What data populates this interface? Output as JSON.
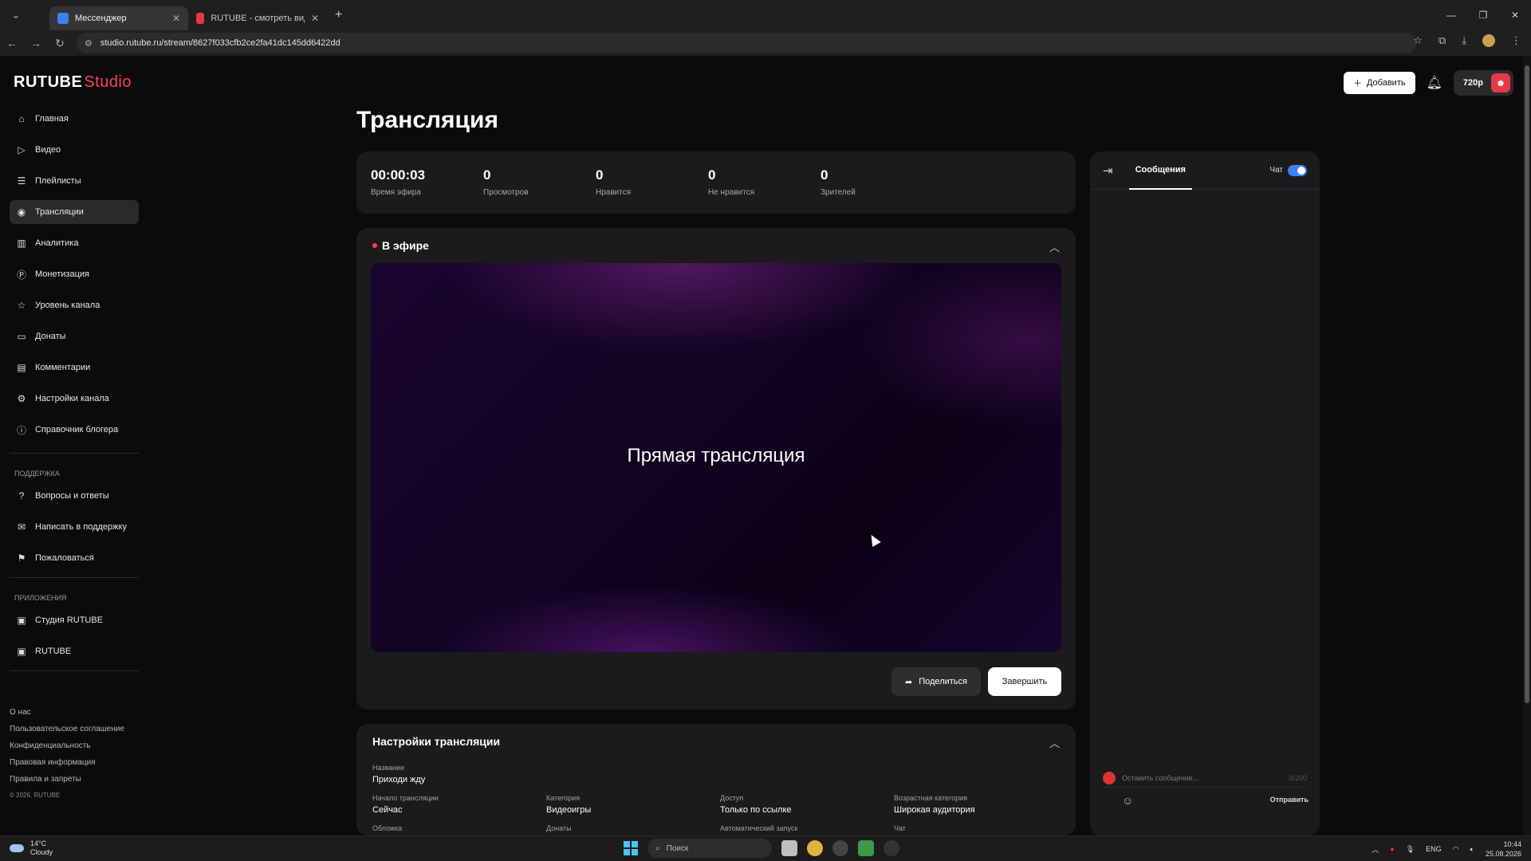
{
  "browser": {
    "tabs": [
      {
        "label": "Мессенджер",
        "active": true
      },
      {
        "label": "RUTUBE - смотреть видео он...",
        "active": false
      }
    ],
    "url": "studio.rutube.ru/stream/8627f033cfb2ce2fa41dc145dd6422dd"
  },
  "brand": {
    "logo": "RUTUBE",
    "logo_suffix": "Studio",
    "accent": "#ff3d5a"
  },
  "sidebar": {
    "items": [
      {
        "label": "Главная",
        "icon": "home-icon"
      },
      {
        "label": "Видео",
        "icon": "video-icon"
      },
      {
        "label": "Плейлисты",
        "icon": "playlist-icon"
      },
      {
        "label": "Трансляции",
        "icon": "broadcast-icon",
        "active": true
      },
      {
        "label": "Аналитика",
        "icon": "analytics-icon"
      },
      {
        "label": "Монетизация",
        "icon": "monetization-icon"
      },
      {
        "label": "Уровень канала",
        "icon": "star-icon"
      },
      {
        "label": "Донаты",
        "icon": "wallet-icon"
      },
      {
        "label": "Комментарии",
        "icon": "comment-icon"
      },
      {
        "label": "Настройки канала",
        "icon": "gear-icon"
      },
      {
        "label": "Справочник блогера",
        "icon": "info-icon"
      }
    ],
    "support_title": "ПОДДЕРЖКА",
    "support": [
      {
        "label": "Вопросы и ответы",
        "icon": "question-icon"
      },
      {
        "label": "Написать в поддержку",
        "icon": "mail-icon"
      },
      {
        "label": "Пожаловаться",
        "icon": "flag-icon"
      }
    ],
    "apps_title": "ПРИЛОЖЕНИЯ",
    "apps": [
      {
        "label": "Студия RUTUBE",
        "icon": "studio-icon"
      },
      {
        "label": "RUTUBE",
        "icon": "rutube-icon"
      }
    ],
    "footer": [
      "О нас",
      "Пользовательское соглашение",
      "Конфиденциальность",
      "Правовая информация",
      "Правила и запреты"
    ],
    "copyright": "© 2026, RUTUBE"
  },
  "header": {
    "add_label": "Добавить",
    "quality": "720p"
  },
  "page_title": "Трансляция",
  "stats": [
    {
      "value": "00:00:03",
      "label": "Время эфира"
    },
    {
      "value": "0",
      "label": "Просмотров"
    },
    {
      "value": "0",
      "label": "Нравится"
    },
    {
      "value": "0",
      "label": "Не нравится"
    },
    {
      "value": "0",
      "label": "Зрителей"
    }
  ],
  "live": {
    "status": "В эфире",
    "player_label": "Прямая трансляция",
    "share_label": "Поделиться",
    "end_label": "Завершить"
  },
  "settings": {
    "title": "Настройки трансляции",
    "name_key": "Название",
    "name_value": "Приходи жду",
    "fields": [
      {
        "key": "Начало трансляции",
        "value": "Сейчас"
      },
      {
        "key": "Категория",
        "value": "Видеоигры"
      },
      {
        "key": "Доступ",
        "value": "Только по ссылке"
      },
      {
        "key": "Возрастная категория",
        "value": "Широкая аудитория"
      },
      {
        "key": "Обложка",
        "value": ""
      },
      {
        "key": "Донаты",
        "value": ""
      },
      {
        "key": "Автоматический запуск",
        "value": ""
      },
      {
        "key": "Чат",
        "value": ""
      }
    ]
  },
  "chat": {
    "tab_label": "Сообщения",
    "toggle_label": "Чат",
    "toggle_on": true,
    "input_placeholder": "Оставить сообщение...",
    "counter": "0/200",
    "send_label": "Отправить"
  },
  "taskbar": {
    "temp": "14°C",
    "weather": "Cloudy",
    "search_placeholder": "Поиск",
    "lang": "ENG",
    "time": "10:44",
    "date": "25.08.2026"
  }
}
